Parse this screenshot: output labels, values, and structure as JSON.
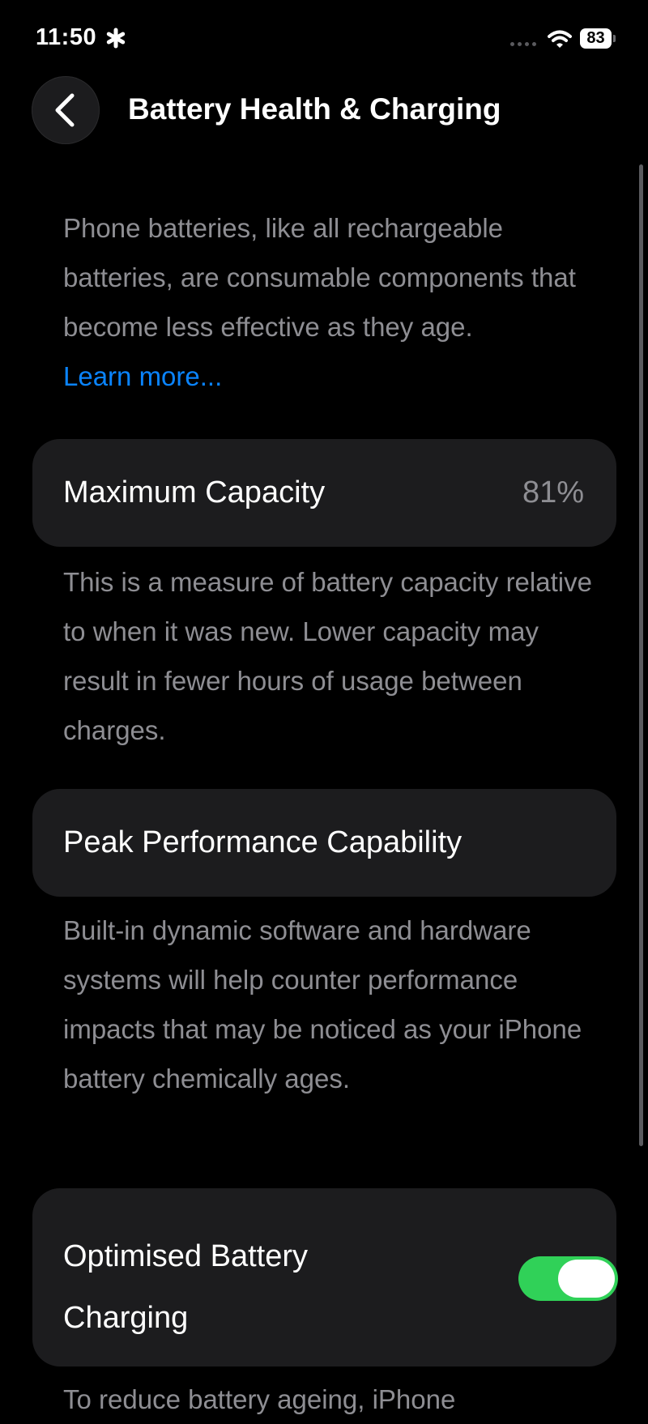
{
  "status_bar": {
    "time": "11:50",
    "battery_level": "83"
  },
  "nav": {
    "title": "Battery Health & Charging",
    "back_icon": "chevron-left-icon"
  },
  "intro": {
    "text": "Phone batteries, like all rechargeable batteries, are consumable components that become less effective as they age.",
    "link": "Learn more..."
  },
  "max_capacity": {
    "label": "Maximum Capacity",
    "value": "81%",
    "footer": "This is a measure of battery capacity relative to when it was new. Lower capacity may result in fewer hours of usage between charges."
  },
  "peak_performance": {
    "label": "Peak Performance Capability",
    "footer": "Built-in dynamic software and hardware systems will help counter performance impacts that may be noticed as your iPhone battery chemically ages."
  },
  "optimised_charging": {
    "label": "Optimised Battery Charging",
    "enabled": true,
    "footer_partial": "To reduce battery ageing, iPhone"
  },
  "colors": {
    "background": "#000000",
    "card": "#1c1c1e",
    "secondary_text": "#8e8e93",
    "link": "#0a84ff",
    "toggle_on": "#30d158"
  }
}
